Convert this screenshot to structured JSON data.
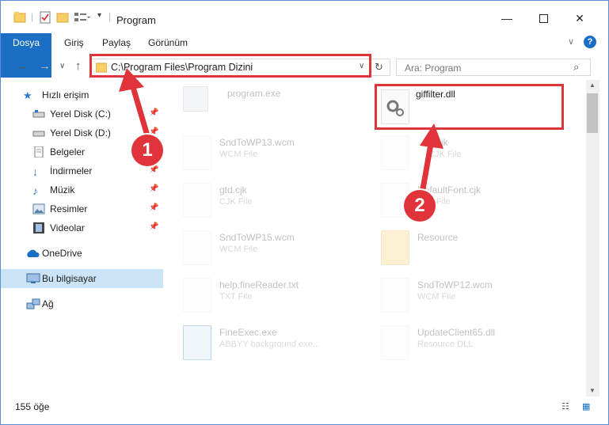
{
  "window": {
    "title": "Program"
  },
  "ribbon": {
    "tabs": [
      "Dosya",
      "Giriş",
      "Paylaş",
      "Görünüm"
    ]
  },
  "address": {
    "path": "C:\\Program Files\\Program Dizini"
  },
  "search": {
    "placeholder": "Ara: Program"
  },
  "sidebar": {
    "items": [
      {
        "label": "Hızlı erişim",
        "icon": "star-icon"
      },
      {
        "label": "Yerel Disk (C:)",
        "icon": "drive-icon",
        "pinned": true
      },
      {
        "label": "Yerel Disk (D:)",
        "icon": "drive-icon",
        "pinned": true
      },
      {
        "label": "Belgeler",
        "icon": "documents-icon",
        "pinned": true
      },
      {
        "label": "İndirmeler",
        "icon": "download-icon",
        "pinned": true
      },
      {
        "label": "Müzik",
        "icon": "music-icon",
        "pinned": true
      },
      {
        "label": "Resimler",
        "icon": "pictures-icon",
        "pinned": true
      },
      {
        "label": "Videolar",
        "icon": "video-icon",
        "pinned": true
      },
      {
        "label": "OneDrive",
        "icon": "cloud-icon"
      },
      {
        "label": "Bu bilgisayar",
        "icon": "computer-icon",
        "selected": true
      },
      {
        "label": "Ağ",
        "icon": "network-icon"
      }
    ]
  },
  "files": [
    {
      "name": "program.exe",
      "type": "",
      "faded": true
    },
    {
      "name": "giffilter.dll",
      "type": "",
      "faded": false
    },
    {
      "name": "SndToWP13.wcm",
      "type": "WCM File",
      "faded": true
    },
    {
      "name": "...cjk",
      "type": "CJK File",
      "faded": true
    },
    {
      "name": "gtd.cjk",
      "type": "CJK File",
      "faded": true
    },
    {
      "name": "DefaultFont.cjk",
      "type": "CJK File",
      "faded": true
    },
    {
      "name": "SndToWP15.wcm",
      "type": "WCM File",
      "faded": true
    },
    {
      "name": "Resource",
      "type": "",
      "faded": true
    },
    {
      "name": "help.fineReader.txt",
      "type": "TXT File",
      "faded": true
    },
    {
      "name": "SndToWP12.wcm",
      "type": "WCM File",
      "faded": true
    },
    {
      "name": "FineExec.exe",
      "type": "ABBYY background exe...",
      "faded": true
    },
    {
      "name": "UpdateClient65.dll",
      "type": "Resource DLL",
      "faded": true
    }
  ],
  "status": {
    "count": "155 öğe"
  },
  "annotations": {
    "step1": "1",
    "step2": "2",
    "color": "#e0333a"
  }
}
